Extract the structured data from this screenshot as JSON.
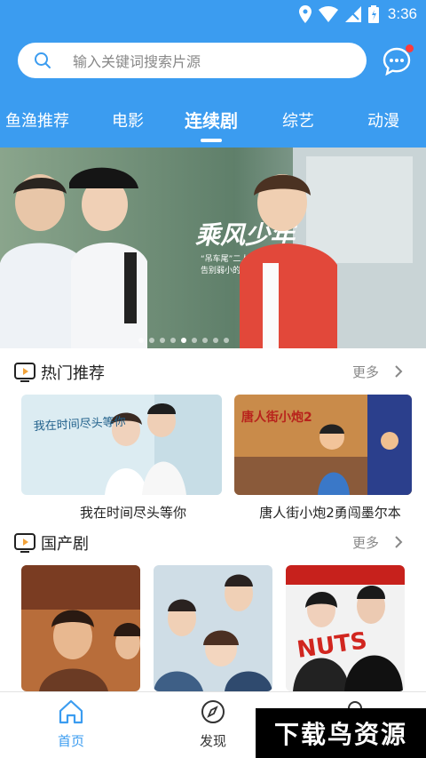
{
  "status_bar": {
    "time": "3:36"
  },
  "search": {
    "placeholder": "输入关键词搜索片源"
  },
  "tabs": [
    {
      "label": "鱼渔推荐"
    },
    {
      "label": "电影"
    },
    {
      "label": "连续剧"
    },
    {
      "label": "综艺"
    },
    {
      "label": "动漫"
    }
  ],
  "banner": {
    "title_art": "乘风少年",
    "caption_line1": "“吊车尾”二人组 意外反击",
    "caption_line2": "告别弱小的少年开始逆袭",
    "slides": 9,
    "active_slide": 5
  },
  "hot": {
    "title": "热门推荐",
    "more": "更多",
    "items": [
      {
        "caption": "我在时间尽头等你",
        "poster_text": "我在时间尽头等你"
      },
      {
        "caption": "唐人街小炮2勇闯墨尔本",
        "poster_text": "唐人街小炮2"
      }
    ]
  },
  "domestic": {
    "title": "国产剧",
    "more": "更多",
    "items": [
      {
        "poster_text": ""
      },
      {
        "poster_text": ""
      },
      {
        "poster_text": "NUTS"
      }
    ]
  },
  "bottom_nav": {
    "home": "首页",
    "discover": "发现",
    "watermark": "下载鸟资源"
  },
  "colors": {
    "accent": "#3b9cf0",
    "active_nav": "#3b9cf0",
    "badge": "#ff3b3b"
  }
}
